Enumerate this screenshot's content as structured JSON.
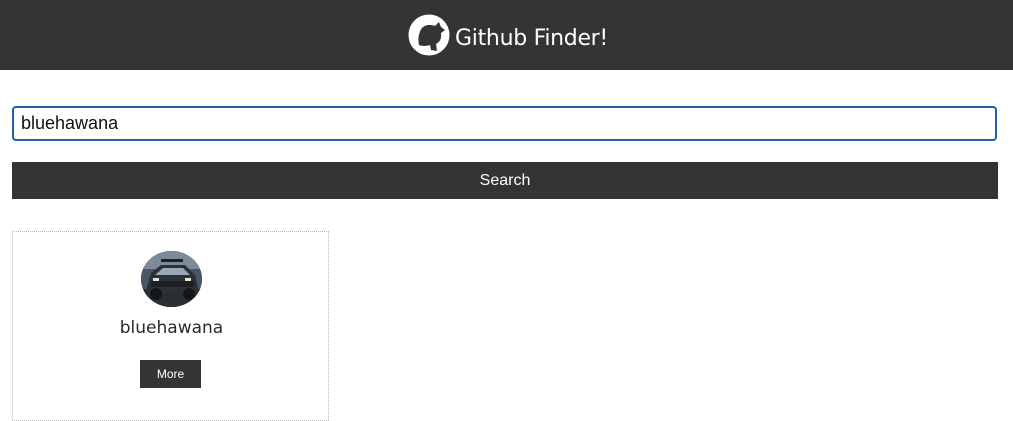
{
  "header": {
    "title": "Github Finder!",
    "icon": "github-logo-icon"
  },
  "search": {
    "value": "bluehawana",
    "button_label": "Search"
  },
  "results": [
    {
      "username": "bluehawana",
      "avatar": "user-avatar",
      "more_label": "More"
    }
  ],
  "colors": {
    "navbar": "#353434",
    "button": "#353434",
    "input_border": "#1f5fa8",
    "text": "#2a2a2a"
  }
}
